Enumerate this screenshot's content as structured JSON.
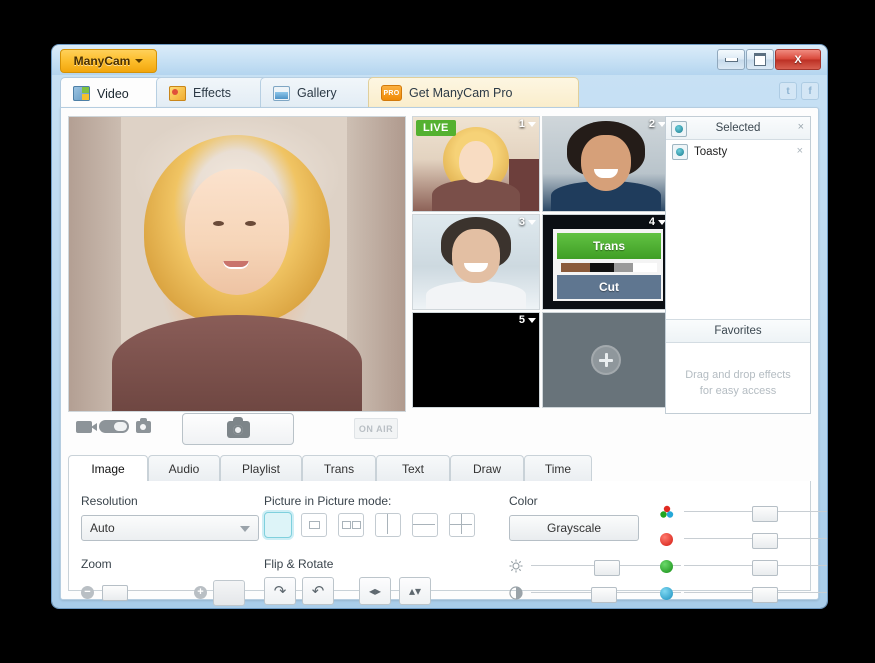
{
  "window": {
    "app_menu_label": "ManyCam",
    "minimize_label": "Minimize",
    "maximize_label": "Maximize",
    "close_label": "X"
  },
  "tabs": [
    {
      "label": "Video",
      "icon": "video-icon",
      "active": true
    },
    {
      "label": "Effects",
      "icon": "effects-icon",
      "active": false
    },
    {
      "label": "Gallery",
      "icon": "gallery-icon",
      "active": false
    },
    {
      "label": "Get ManyCam Pro",
      "icon": "pro-badge-icon",
      "active": false,
      "badge": "PRO"
    }
  ],
  "socials": [
    {
      "name": "twitter-icon",
      "glyph": "t"
    },
    {
      "name": "facebook-icon",
      "glyph": "f"
    }
  ],
  "preview": {
    "toolbar": {
      "record_icon": "video-record-icon",
      "mode_toggle": "record-photo-toggle",
      "photo_icon": "photo-icon",
      "snapshot_label": "snapshot-camera-icon",
      "on_air_label": "ON AIR"
    }
  },
  "thumbnails": [
    {
      "num": "1",
      "live_badge": "LIVE",
      "kind": "webcam-woman"
    },
    {
      "num": "2",
      "live_badge": "",
      "kind": "webcam-man"
    },
    {
      "num": "3",
      "live_badge": "",
      "kind": "webcam-woman-2"
    },
    {
      "num": "4",
      "live_badge": "",
      "kind": "desktop-capture",
      "overlay_top": "Trans",
      "overlay_bottom": "Cut"
    },
    {
      "num": "5",
      "live_badge": "",
      "kind": "blank-black"
    },
    {
      "num": "",
      "live_badge": "",
      "kind": "add-source"
    }
  ],
  "effects_panel": {
    "selected_header": "Selected",
    "selected_close": "×",
    "items": [
      {
        "label": "Toasty",
        "close": "×",
        "icon": "effect-icon"
      }
    ],
    "favorites_header": "Favorites",
    "favorites_hint_line1": "Drag and drop effects",
    "favorites_hint_line2": "for easy access"
  },
  "lower_tabs": [
    {
      "label": "Image",
      "active": true
    },
    {
      "label": "Audio",
      "active": false
    },
    {
      "label": "Playlist",
      "active": false
    },
    {
      "label": "Trans",
      "active": false
    },
    {
      "label": "Text",
      "active": false
    },
    {
      "label": "Draw",
      "active": false
    },
    {
      "label": "Time",
      "active": false
    }
  ],
  "image_panel": {
    "resolution_label": "Resolution",
    "resolution_value": "Auto",
    "zoom_label": "Zoom",
    "zoom_minus": "−",
    "zoom_plus": "+",
    "pip_label": "Picture in Picture mode:",
    "pip_modes": [
      {
        "name": "pip-mode-full",
        "selected": true
      },
      {
        "name": "pip-mode-single-inset",
        "selected": false
      },
      {
        "name": "pip-mode-double-inset",
        "selected": false
      },
      {
        "name": "pip-mode-vsplit",
        "selected": false
      },
      {
        "name": "pip-mode-hsplit",
        "selected": false
      },
      {
        "name": "pip-mode-quad",
        "selected": false
      }
    ],
    "flip_label": "Flip & Rotate",
    "rotate_cw": "↷",
    "rotate_ccw": "↶",
    "flip_h": "◂▸",
    "flip_v": "▴▾",
    "color_label": "Color",
    "grayscale_label": "Grayscale",
    "brightness_icon": "brightness-icon",
    "contrast_icon": "contrast-icon",
    "sliders": [
      {
        "name": "saturation-slider",
        "icon_color": "multi",
        "value_pct": 50
      },
      {
        "name": "red-slider",
        "icon_color": "#e02a21",
        "value_pct": 50
      },
      {
        "name": "green-slider",
        "icon_color": "#21a521",
        "value_pct": 50
      },
      {
        "name": "blue-slider",
        "icon_color": "#25a8d8",
        "value_pct": 50
      },
      {
        "name": "brightness-slider",
        "icon_color": "",
        "value_pct": 50
      },
      {
        "name": "contrast-slider",
        "icon_color": "",
        "value_pct": 48
      }
    ],
    "zoom_slider_value_pct": 2
  },
  "colors": {
    "accent_orange": "#fcbd2c",
    "live_green": "#54b130",
    "close_red": "#d9483a",
    "selection_cyan": "#7fd0dd"
  }
}
